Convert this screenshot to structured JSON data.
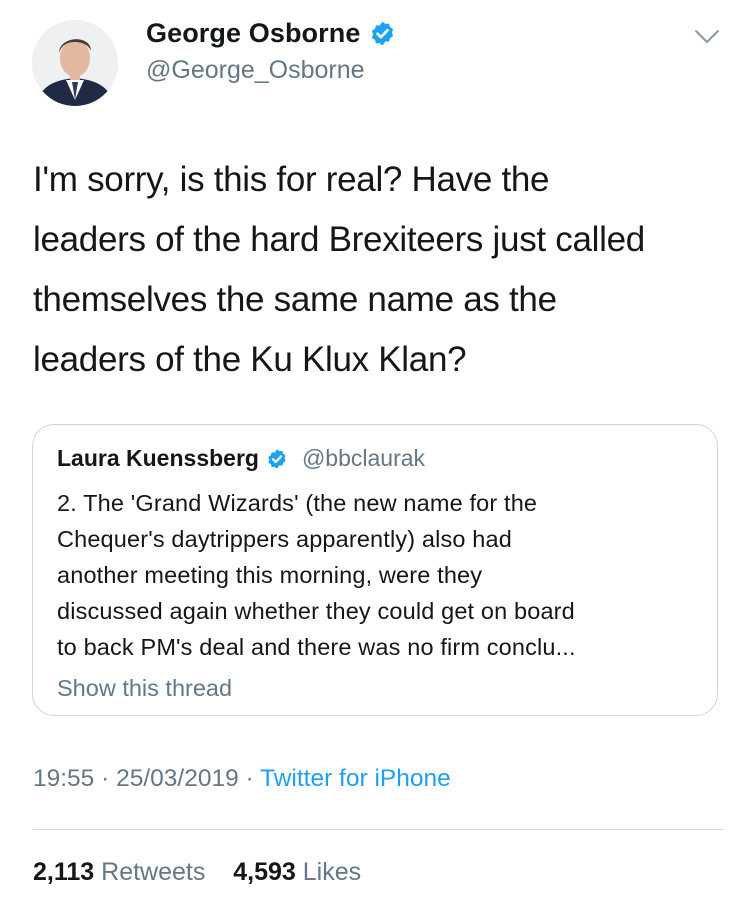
{
  "author": {
    "display_name": "George Osborne",
    "handle": "@George_Osborne",
    "verified": true
  },
  "tweet": {
    "lines": [
      "I'm sorry, is this for real? Have the",
      "leaders of the hard Brexiteers just called",
      "themselves the same name as the",
      "leaders of the Ku Klux Klan?"
    ]
  },
  "quote": {
    "display_name": "Laura Kuenssberg",
    "handle": "@bbclaurak",
    "verified": true,
    "lines": [
      "2. The 'Grand Wizards' (the new name for the",
      "Chequer's daytrippers apparently) also had",
      "another meeting this morning, were they",
      "discussed again whether they could get on board",
      "to back PM's deal and there was no firm conclu..."
    ],
    "show_thread": "Show this thread"
  },
  "meta": {
    "time": "19:55",
    "separator": "·",
    "date": "25/03/2019",
    "source": "Twitter for iPhone"
  },
  "stats": {
    "retweets_count": "2,113",
    "retweets_label": "Retweets",
    "likes_count": "4,593",
    "likes_label": "Likes"
  },
  "colors": {
    "text_primary": "#14171a",
    "text_secondary": "#657786",
    "link_blue": "#1da1f2",
    "verified_blue": "#1da1f2",
    "border": "#ccd6dd"
  },
  "icons": {
    "verified": "verified-badge-icon",
    "more": "chevron-down-icon"
  }
}
